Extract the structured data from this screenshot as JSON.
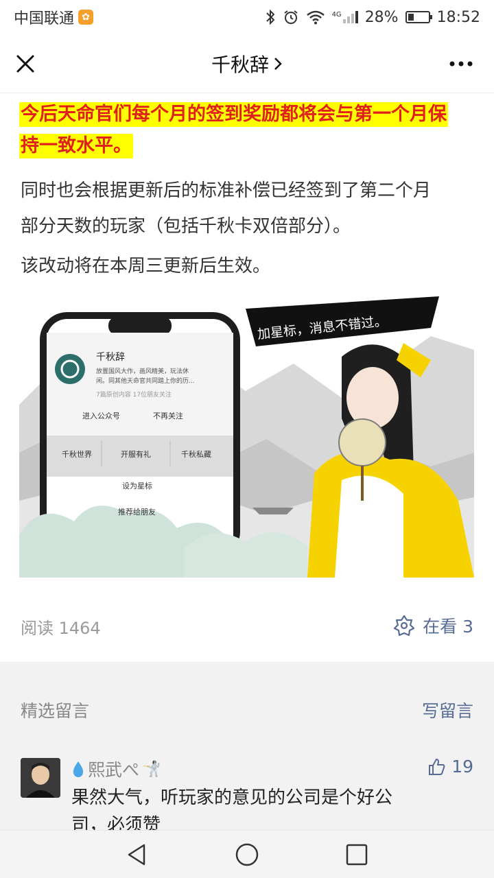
{
  "status_bar": {
    "carrier": "中国联通",
    "network": "4G",
    "battery": "28%",
    "battery_level": 0.28,
    "time": "18:52",
    "icons": [
      "bluetooth-icon",
      "alarm-icon",
      "wifi-icon",
      "signal-icon",
      "battery-icon"
    ]
  },
  "nav": {
    "title": "千秋辞",
    "icons": [
      "close-icon",
      "chevron-right-icon",
      "more-icon"
    ]
  },
  "article": {
    "highlight_line1": "今后天命官们每个月的签到奖励都将会与第一个月保",
    "highlight_line2": "持一致水平。",
    "para1_line1": "同时也会根据更新后的标准补偿已经签到了第二个月",
    "para1_line2": "部分天数的玩家（包括千秋卡双倍部分）。",
    "para2": "该改动将在本周三更新后生效。",
    "image": {
      "banner_text": "加星标，消息不错过。",
      "account_name": "千秋辞",
      "account_desc1": "放置国风大作，画风精美，玩法休",
      "account_desc2": "闲。同其他天命官共同踏上你的历...",
      "account_stats": "7篇原创内容  17位朋友关注",
      "enter_button": "进入公众号",
      "unfollow_button": "不再关注",
      "menu_items": [
        "千秋世界",
        "开服有礼",
        "千秋私藏"
      ],
      "sheet_item1": "设为星标",
      "sheet_item2": "推荐给朋友"
    }
  },
  "footer": {
    "reads_label": "阅读 1464",
    "looking_label": "在看 3"
  },
  "comments": {
    "section_title": "精选留言",
    "write_label": "写留言",
    "items": [
      {
        "name": "熙武ぺ",
        "likes": "19",
        "text_line1": "果然大气，听玩家的意见的公司是个好公",
        "text_line2": "司，必须赞"
      }
    ]
  },
  "colors": {
    "accent_link": "#576b95",
    "highlight_bg": "#ffff00",
    "highlight_text": "#e0211b"
  }
}
